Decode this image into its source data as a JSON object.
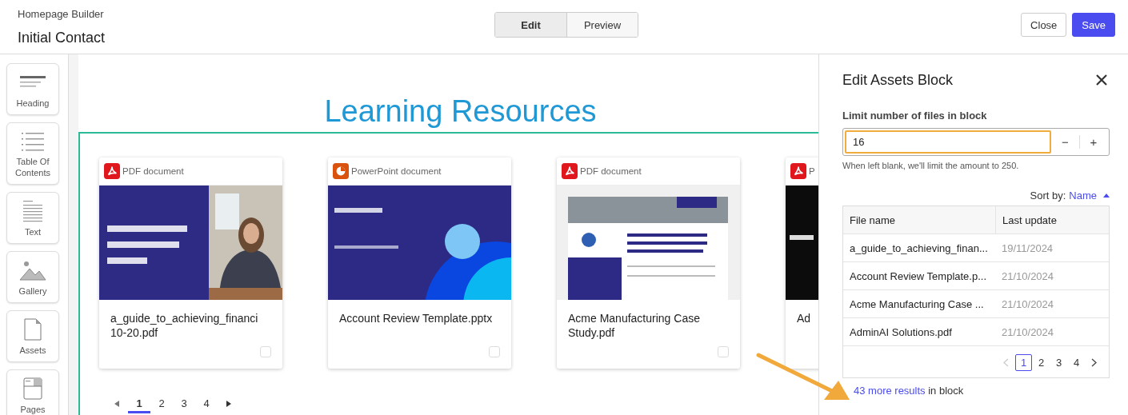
{
  "header": {
    "app_name": "Homepage Builder",
    "page_title": "Initial Contact",
    "view_tabs": [
      {
        "label": "Edit",
        "selected": true
      },
      {
        "label": "Preview",
        "selected": false
      }
    ],
    "buttons": [
      {
        "label": "Close",
        "kind": "secondary"
      },
      {
        "label": "Save",
        "kind": "primary"
      }
    ]
  },
  "sidebar": {
    "blocks": [
      {
        "label": "Heading",
        "kind": "heading"
      },
      {
        "label": "Table Of Contents",
        "kind": "toc"
      },
      {
        "label": "Text",
        "kind": "text"
      },
      {
        "label": "Gallery",
        "kind": "gallery"
      },
      {
        "label": "Assets",
        "kind": "assets"
      },
      {
        "label": "Pages",
        "kind": "pages"
      }
    ]
  },
  "canvas": {
    "title": "Learning Resources",
    "cards": [
      {
        "kind": "pdf",
        "type_label": "PDF document",
        "name": "a_guide_to_achieving_financi\n10-20.pdf",
        "checked": false
      },
      {
        "kind": "pptx",
        "type_label": "PowerPoint document",
        "name": "Account Review Template.pptx",
        "checked": false
      },
      {
        "kind": "pdf",
        "type_label": "PDF document",
        "name": "Acme Manufacturing Case Study.pdf",
        "checked": false
      },
      {
        "kind": "pdf",
        "type_label": "P",
        "name": "Ad"
      }
    ],
    "pagination": [
      {
        "label": "1",
        "selected": true
      },
      {
        "label": "2",
        "selected": false
      },
      {
        "label": "3",
        "selected": false
      },
      {
        "label": "4",
        "selected": false
      }
    ]
  },
  "panel": {
    "title": "Edit Assets Block",
    "limit": {
      "label": "Limit number of files in block",
      "value": "16",
      "hint": "When left blank, we'll limit the amount to 250.",
      "minus": "−",
      "plus": "+"
    },
    "sort": {
      "label": "Sort by:",
      "value": "Name"
    },
    "table": {
      "columns": [
        "File name",
        "Last update"
      ],
      "rows": [
        {
          "name": "a_guide_to_achieving_finan...",
          "date": "19/11/2024"
        },
        {
          "name": "Account Review Template.p...",
          "date": "21/10/2024"
        },
        {
          "name": "Acme Manufacturing Case ...",
          "date": "21/10/2024"
        },
        {
          "name": "AdminAI Solutions.pdf",
          "date": "21/10/2024"
        }
      ]
    },
    "pagination": [
      {
        "label": "1",
        "selected": true
      },
      {
        "label": "2",
        "selected": false
      },
      {
        "label": "3",
        "selected": false
      },
      {
        "label": "4",
        "selected": false
      }
    ],
    "more_results": {
      "link": "43 more results",
      "rest": "in block"
    }
  }
}
